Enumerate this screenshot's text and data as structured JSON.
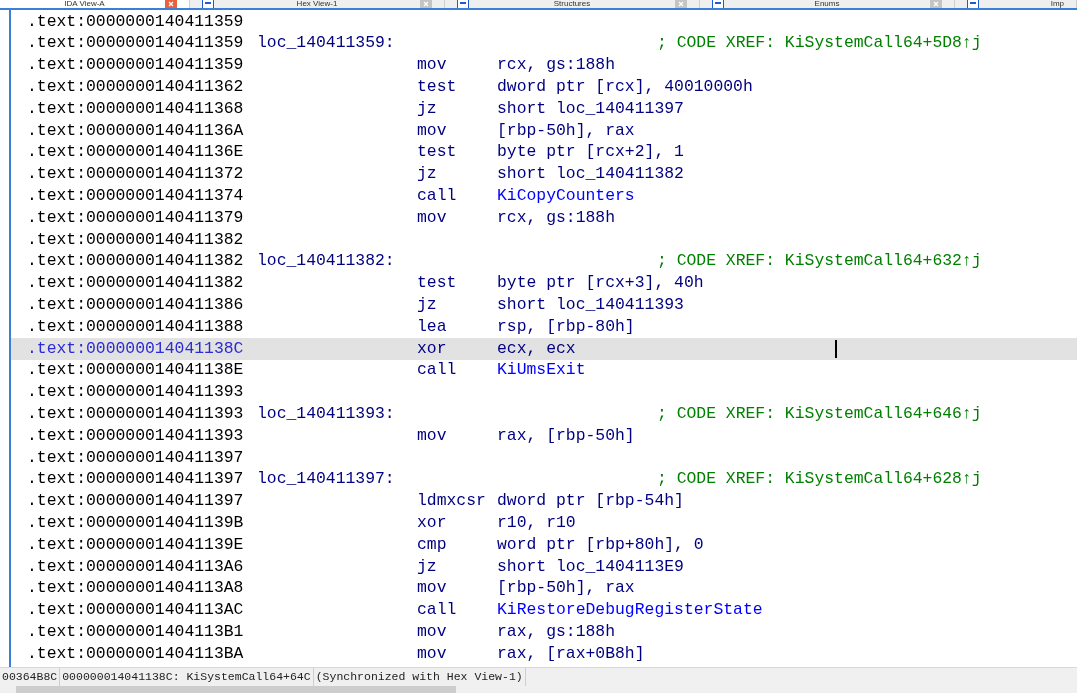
{
  "tabs": [
    {
      "label": "IDA View-A",
      "selected": true
    },
    {
      "label": "Hex View-1",
      "selected": false
    },
    {
      "label": "Structures",
      "selected": false
    },
    {
      "label": "Enums",
      "selected": false
    },
    {
      "label": "Imp",
      "selected": false
    }
  ],
  "rows": [
    {
      "addr": ".text:0000000140411359",
      "selected": false
    },
    {
      "addr": ".text:0000000140411359",
      "label": "loc_140411359:",
      "comment": "; CODE XREF: KiSystemCall64+5D8↑j",
      "selected": false
    },
    {
      "addr": ".text:0000000140411359",
      "mnem": "mov",
      "ops": "rcx, gs:188h",
      "selected": false
    },
    {
      "addr": ".text:0000000140411362",
      "mnem": "test",
      "ops": "dword ptr [rcx], 40010000h",
      "selected": false
    },
    {
      "addr": ".text:0000000140411368",
      "mnem": "jz",
      "ops": "short loc_140411397",
      "selected": false
    },
    {
      "addr": ".text:000000014041136A",
      "mnem": "mov",
      "ops": "[rbp-50h], rax",
      "selected": false
    },
    {
      "addr": ".text:000000014041136E",
      "mnem": "test",
      "ops": "byte ptr [rcx+2], 1",
      "selected": false
    },
    {
      "addr": ".text:0000000140411372",
      "mnem": "jz",
      "ops": "short loc_140411382",
      "selected": false
    },
    {
      "addr": ".text:0000000140411374",
      "mnem": "call",
      "target": "KiCopyCounters",
      "selected": false
    },
    {
      "addr": ".text:0000000140411379",
      "mnem": "mov",
      "ops": "rcx, gs:188h",
      "selected": false
    },
    {
      "addr": ".text:0000000140411382",
      "selected": false
    },
    {
      "addr": ".text:0000000140411382",
      "label": "loc_140411382:",
      "comment": "; CODE XREF: KiSystemCall64+632↑j",
      "selected": false
    },
    {
      "addr": ".text:0000000140411382",
      "mnem": "test",
      "ops": "byte ptr [rcx+3], 40h",
      "selected": false
    },
    {
      "addr": ".text:0000000140411386",
      "mnem": "jz",
      "ops": "short loc_140411393",
      "selected": false
    },
    {
      "addr": ".text:0000000140411388",
      "mnem": "lea",
      "ops": "rsp, [rbp-80h]",
      "selected": false
    },
    {
      "addr": ".text:000000014041138C",
      "mnem": "xor",
      "ops": "ecx, ecx",
      "selected": true
    },
    {
      "addr": ".text:000000014041138E",
      "mnem": "call",
      "target": "KiUmsExit",
      "selected": false
    },
    {
      "addr": ".text:0000000140411393",
      "selected": false
    },
    {
      "addr": ".text:0000000140411393",
      "label": "loc_140411393:",
      "comment": "; CODE XREF: KiSystemCall64+646↑j",
      "selected": false
    },
    {
      "addr": ".text:0000000140411393",
      "mnem": "mov",
      "ops": "rax, [rbp-50h]",
      "selected": false
    },
    {
      "addr": ".text:0000000140411397",
      "selected": false
    },
    {
      "addr": ".text:0000000140411397",
      "label": "loc_140411397:",
      "comment": "; CODE XREF: KiSystemCall64+628↑j",
      "selected": false
    },
    {
      "addr": ".text:0000000140411397",
      "mnem": "ldmxcsr",
      "ops": "dword ptr [rbp-54h]",
      "selected": false
    },
    {
      "addr": ".text:000000014041139B",
      "mnem": "xor",
      "ops": "r10, r10",
      "selected": false
    },
    {
      "addr": ".text:000000014041139E",
      "mnem": "cmp",
      "ops": "word ptr [rbp+80h], 0",
      "selected": false
    },
    {
      "addr": ".text:00000001404113A6",
      "mnem": "jz",
      "ops": "short loc_1404113E9",
      "selected": false
    },
    {
      "addr": ".text:00000001404113A8",
      "mnem": "mov",
      "ops": "[rbp-50h], rax",
      "selected": false
    },
    {
      "addr": ".text:00000001404113AC",
      "mnem": "call",
      "target": "KiRestoreDebugRegisterState",
      "selected": false
    },
    {
      "addr": ".text:00000001404113B1",
      "mnem": "mov",
      "ops": "rax, gs:188h",
      "selected": false
    },
    {
      "addr": ".text:00000001404113BA",
      "mnem": "mov",
      "ops": "rax, [rax+0B8h]",
      "selected": false
    }
  ],
  "status_bar": [
    "00364B8C",
    "000000014041138C: KiSystemCall64+64C",
    "(Synchronized with Hex View-1)"
  ]
}
